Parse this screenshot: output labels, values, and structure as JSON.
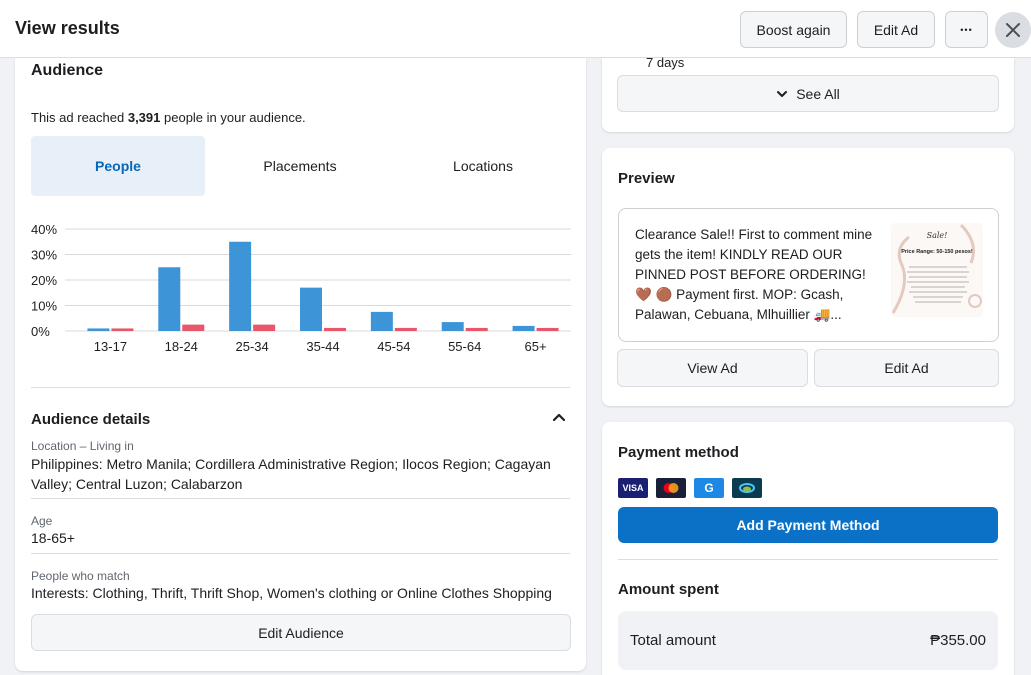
{
  "header": {
    "title": "View results",
    "boost_again": "Boost again",
    "edit_ad": "Edit Ad",
    "more": "•••"
  },
  "audience": {
    "title": "Audience",
    "reached_prefix": "This ad reached ",
    "reached_count": "3,391",
    "reached_suffix": " people in your audience.",
    "tabs": [
      "People",
      "Placements",
      "Locations"
    ],
    "details_title": "Audience details",
    "location_label": "Location – Living in",
    "location_value": "Philippines: Metro Manila; Cordillera Administrative Region; Ilocos Region; Cagayan Valley; Central Luzon; Calabarzon",
    "age_label": "Age",
    "age_value": "18-65+",
    "match_label": "People who match",
    "match_value": "Interests: Clothing, Thrift, Thrift Shop, Women's clothing or Online Clothes Shopping",
    "edit_audience": "Edit Audience"
  },
  "chart_data": {
    "type": "bar",
    "categories": [
      "13-17",
      "18-24",
      "25-34",
      "35-44",
      "45-54",
      "55-64",
      "65+"
    ],
    "series": [
      {
        "color": "#3d95d8",
        "values": [
          1,
          25,
          35,
          17,
          7.5,
          3.5,
          2
        ]
      },
      {
        "color": "#e8566a",
        "values": [
          1,
          2.5,
          2.5,
          1.2,
          1.2,
          1.2,
          1.2
        ]
      }
    ],
    "yticks": [
      "0%",
      "10%",
      "20%",
      "30%",
      "40%"
    ],
    "ylim": [
      0,
      40
    ],
    "grid": true
  },
  "duration": {
    "days": "7 days",
    "see_all": "See All"
  },
  "preview": {
    "title": "Preview",
    "text": "Clearance Sale!! First to comment mine gets the item! KINDLY READ OUR PINNED POST BEFORE ORDERING! 🤎 🟤 Payment first. MOP: Gcash, Palawan, Cebuana, Mlhuillier 🚚...",
    "thumb_title": "Sale!",
    "thumb_price": "Price Range: 50-150 pesos!",
    "view_ad": "View Ad",
    "edit_ad": "Edit Ad"
  },
  "payment": {
    "title": "Payment method",
    "cards": [
      "VISA",
      "mastercard",
      "G",
      "wallet"
    ],
    "add_method": "Add Payment Method",
    "amount_title": "Amount spent",
    "total_label": "Total amount",
    "total_value": "₱355.00"
  },
  "colors": {
    "accent": "#0a71c7",
    "active_tab_bg": "#e7f0f8",
    "bar_primary": "#3d95d8",
    "bar_secondary": "#e8566a"
  }
}
